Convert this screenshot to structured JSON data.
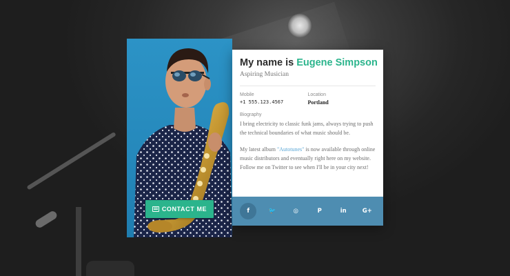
{
  "profile": {
    "headline_prefix": "My name is",
    "name": "Eugene Simpson",
    "subtitle": "Aspiring Musician",
    "mobile_label": "Mobile",
    "mobile_value": "+1 555.123.4567",
    "location_label": "Location",
    "location_value": "Portland",
    "bio_label": "Biography",
    "bio_p1": "I bring electricity to classic funk jams, always trying to push the technical boundaries of what music should be.",
    "bio_p2_before": "My latest album ",
    "bio_p2_link": "\"Autotunes\"",
    "bio_p2_after": " is now available through online music distributors and eventually right here on my website. Follow me on Twitter to see when I'll be in your city next!"
  },
  "contact_button": {
    "label": "CONTACT ME",
    "icon": "menu-icon"
  },
  "social": [
    {
      "name": "facebook",
      "glyph": "f"
    },
    {
      "name": "twitter",
      "glyph": "🐦"
    },
    {
      "name": "instagram",
      "glyph": "◎"
    },
    {
      "name": "pinterest",
      "glyph": "P"
    },
    {
      "name": "linkedin",
      "glyph": "in"
    },
    {
      "name": "google-plus",
      "glyph": "G+"
    }
  ],
  "colors": {
    "accent": "#2bb48c",
    "social_bar": "#4e8db1",
    "link": "#5aa7d6",
    "photo_bg": "#2c93c6"
  }
}
